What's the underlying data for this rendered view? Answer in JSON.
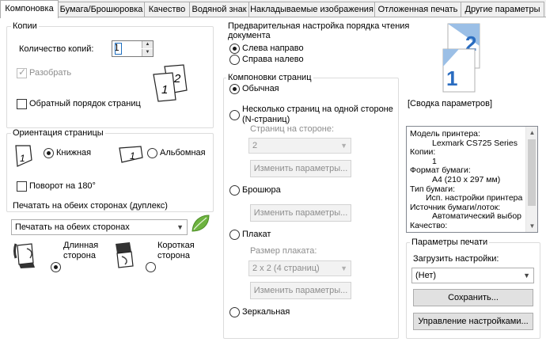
{
  "tabs": [
    {
      "label": "Компоновка"
    },
    {
      "label": "Бумага/Брошюровка"
    },
    {
      "label": "Качество"
    },
    {
      "label": "Водяной знак"
    },
    {
      "label": "Накладываемые изображения"
    },
    {
      "label": "Отложенная печать"
    },
    {
      "label": "Другие параметры"
    }
  ],
  "copies": {
    "group_label": "Копии",
    "count_label": "Количество копий:",
    "count_value": "1",
    "collate_label": "Разобрать",
    "collate_checked": true,
    "reverse_label": "Обратный порядок страниц",
    "reverse_checked": false,
    "icon_page_numbers": [
      "1",
      "2"
    ]
  },
  "orientation": {
    "group_label": "Ориентация страницы",
    "portrait_label": "Книжная",
    "landscape_label": "Альбомная",
    "selected": "portrait",
    "rotate_label": "Поворот на 180°",
    "rotate_checked": false,
    "portrait_icon_number": "1",
    "landscape_icon_number": "1"
  },
  "duplex": {
    "group_label": "Печатать на обеих сторонах (дуплекс)",
    "selected_option": "Печатать на обеих сторонах",
    "long_edge_label": "Длинная\nсторона",
    "short_edge_label": "Короткая\nсторона",
    "selected_edge": "long"
  },
  "reading_order": {
    "group_label": "Предварительная настройка порядка чтения\nдокумента",
    "ltr_label": "Слева направо",
    "rtl_label": "Справа налево",
    "selected": "ltr"
  },
  "page_layouts": {
    "group_label": "Компоновки страниц",
    "normal_label": "Обычная",
    "nup_label": "Несколько страниц на одной стороне\n(N-страниц)",
    "pages_per_side_label": "Страниц на стороне:",
    "pages_per_side_value": "2",
    "change_params_label": "Изменить параметры...",
    "booklet_label": "Брошюра",
    "poster_label": "Плакат",
    "poster_size_label": "Размер плаката:",
    "poster_size_value": "2 x 2 (4 страниц)",
    "mirror_label": "Зеркальная",
    "selected": "normal"
  },
  "preview": {
    "page_numbers": [
      "2",
      "1"
    ]
  },
  "summary": {
    "label": "[Сводка параметров]",
    "lines": [
      {
        "text": "Модель принтера:",
        "indent": 0
      },
      {
        "text": "Lexmark CS725 Series",
        "indent": 1
      },
      {
        "text": "Копии:",
        "indent": 0
      },
      {
        "text": "1",
        "indent": 1
      },
      {
        "text": "Формат бумаги:",
        "indent": 0
      },
      {
        "text": "A4 (210 x 297 мм)",
        "indent": 1
      },
      {
        "text": "Тип бумаги:",
        "indent": 0
      },
      {
        "text": "Исп. настройки принтера",
        "indent": 2
      },
      {
        "text": "Источник бумаги/лоток:",
        "indent": 0
      },
      {
        "text": "Автоматический выбор",
        "indent": 1
      },
      {
        "text": "Качество:",
        "indent": 0
      }
    ]
  },
  "print_params": {
    "group_label": "Параметры печати",
    "load_label": "Загрузить настройки:",
    "load_value": "(Нет)",
    "save_label": "Сохранить...",
    "manage_label": "Управление настройками..."
  },
  "colors": {
    "accent_blue": "#1e6fc0",
    "preview_blue": "#2a6cc0",
    "eco_green": "#6db33f",
    "group_border": "#dcdcdc",
    "disabled_text": "#8d8d8d"
  },
  "icons": [
    "pages-stack-icon",
    "portrait-page-icon",
    "landscape-page-icon",
    "eco-leaf-icon",
    "duplex-long-edge-icon",
    "duplex-short-edge-icon",
    "layout-preview-icon"
  ]
}
